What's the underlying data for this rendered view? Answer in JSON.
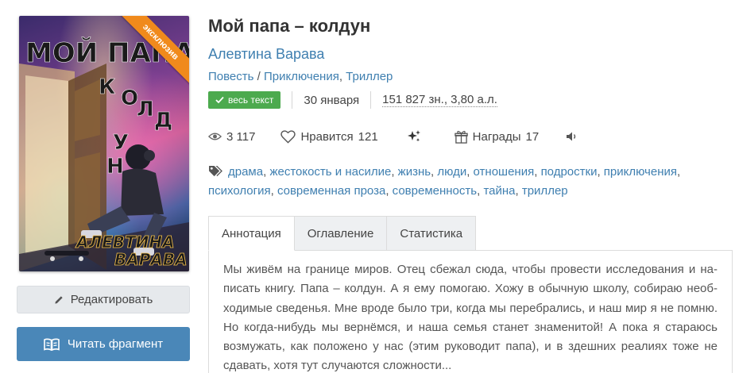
{
  "book": {
    "title": "Мой папа – колдун",
    "author": "Алевтина Варава",
    "genres": [
      "Повесть",
      "Приключения",
      "Триллер"
    ],
    "genre_separators": [
      " / ",
      ", "
    ],
    "cover": {
      "title_text": "МОЙ ПАПА КОЛДУН",
      "author_text": "АЛЕВТИНА ВАРАВА",
      "ribbon": "эксклюзив"
    }
  },
  "meta": {
    "status_badge": "весь текст",
    "date": "30 января",
    "size": "151 827 зн., 3,80 а.л."
  },
  "stats": {
    "views": "3 117",
    "likes_label": "Нравится",
    "likes_count": "121",
    "awards_label": "Награды",
    "awards_count": "17"
  },
  "tags": [
    "драма",
    "жестокость и насилие",
    "жизнь",
    "люди",
    "отношения",
    "подростки",
    "приключения",
    "психология",
    "современная проза",
    "современность",
    "тайна",
    "триллер"
  ],
  "tabs": [
    "Аннотация",
    "Оглавление",
    "Статистика"
  ],
  "annotation": "Мы живём на границе миров. Отец сбежал сюда, чтобы провести исследования и на­писать книгу. Папа – колдун. А я ему помогаю. Хожу в обычную школу, собираю необ­ходимые сведенья. Мне вроде было три, когда мы перебрались, и наш мир я не по­мню. Но когда-нибудь мы вернёмся, и наша семья станет знаменитой! А пока я стара­юсь возмужать, как положено у нас (этим руководит папа), и в здешних реалиях тоже не сдавать, хотя тут случаются сложности...",
  "buttons": {
    "edit": "Редактировать",
    "read": "Читать фрагмент"
  },
  "colors": {
    "link": "#3f7fb0",
    "badge_green": "#4caa4e",
    "ribbon_orange": "#f08a1c",
    "read_button": "#4a87b8"
  }
}
